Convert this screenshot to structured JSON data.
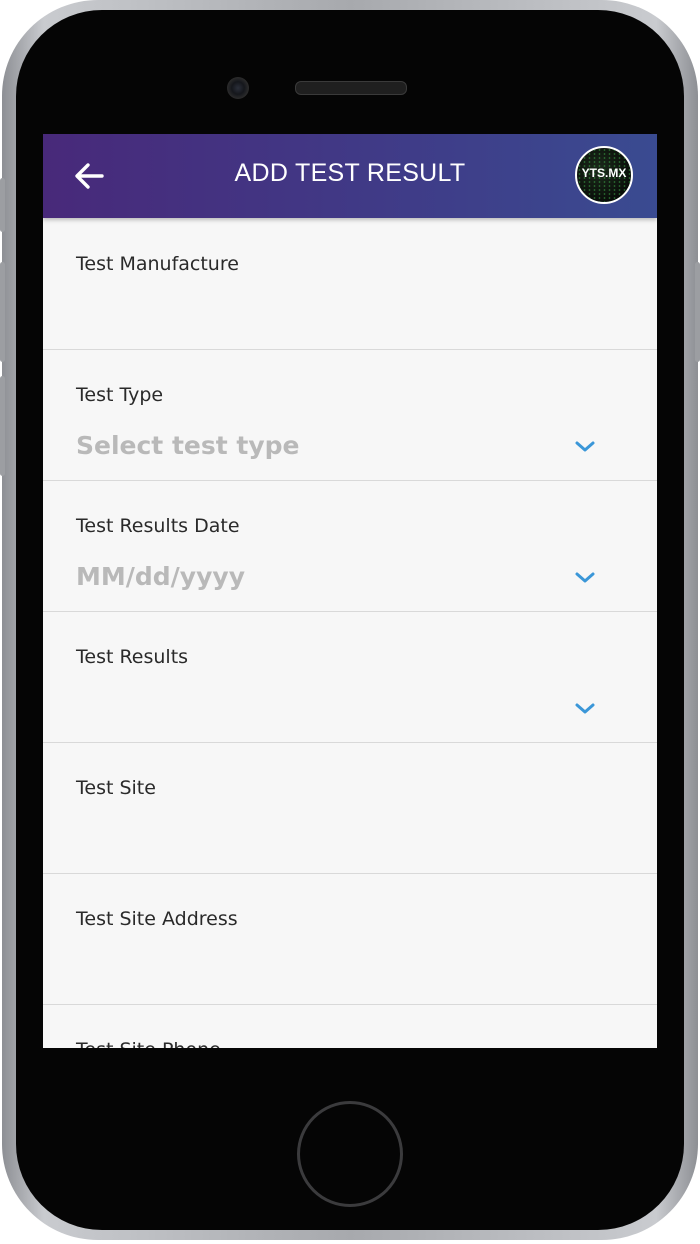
{
  "header": {
    "title": "ADD TEST RESULT",
    "avatar_text": "YTS.MX",
    "accent_color": "#3f3c88"
  },
  "form": {
    "fields": [
      {
        "label": "Test Manufacture",
        "value": "",
        "has_dropdown": false
      },
      {
        "label": "Test Type",
        "value": "Select test type",
        "has_dropdown": true
      },
      {
        "label": "Test Results Date",
        "value": "MM/dd/yyyy",
        "has_dropdown": true
      },
      {
        "label": "Test Results",
        "value": "",
        "has_dropdown": true
      },
      {
        "label": "Test Site",
        "value": "",
        "has_dropdown": false
      },
      {
        "label": "Test Site Address",
        "value": "",
        "has_dropdown": false
      },
      {
        "label": "Test Site Phone",
        "value": "",
        "has_dropdown": false
      }
    ]
  },
  "icons": {
    "back": "arrow-left-icon",
    "dropdown": "chevron-down-icon",
    "chevron_color": "#3b97d8"
  }
}
